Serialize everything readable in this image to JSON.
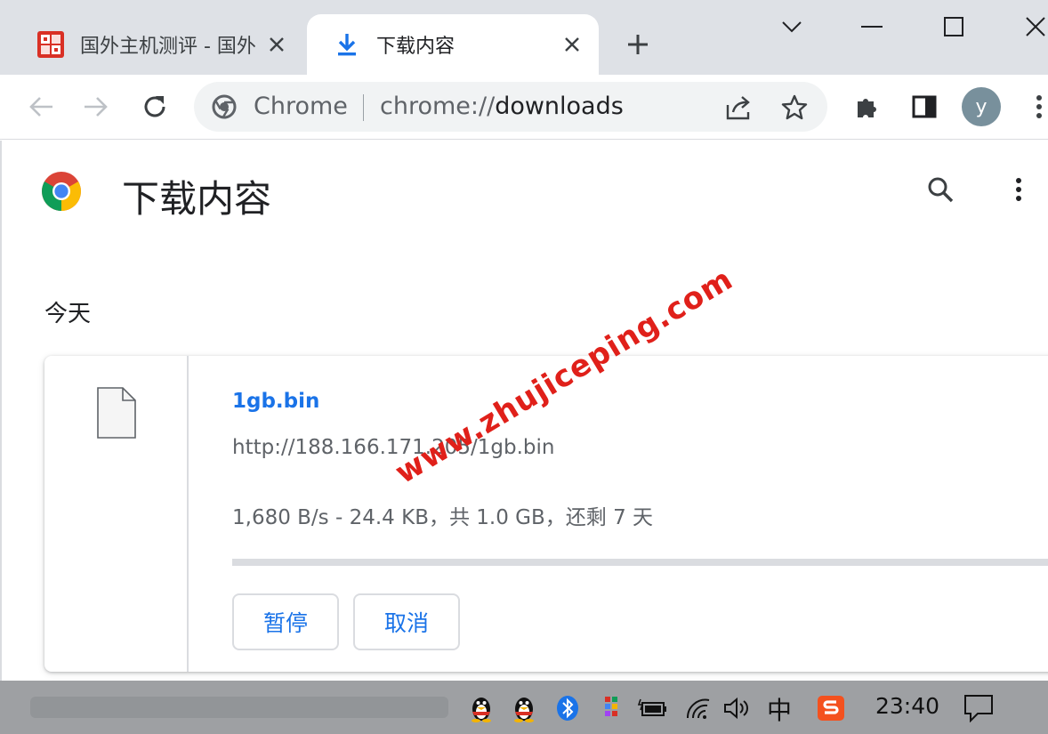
{
  "tabs": [
    {
      "title": "国外主机测评 - 国外",
      "favicon": "site-seal-icon",
      "active": false
    },
    {
      "title": "下载内容",
      "favicon": "download-arrow-icon",
      "active": true
    }
  ],
  "toolbar": {
    "omnibox_scheme": "Chrome",
    "omnibox_url_dim": "chrome://",
    "omnibox_url_main": "downloads",
    "avatar_letter": "y"
  },
  "page": {
    "title": "下载内容",
    "section_date": "今天"
  },
  "download": {
    "file_name": "1gb.bin",
    "url": "http://188.166.171.205/1gb.bin",
    "status": "1,680 B/s - 24.4 KB，共 1.0 GB，还剩 7 天",
    "progress_fraction": 2e-05,
    "pause_label": "暂停",
    "cancel_label": "取消"
  },
  "watermark": "www.zhujiceping.com",
  "taskbar": {
    "ime_label": "中",
    "clock": "23:40"
  },
  "colors": {
    "accent": "#1a73e8",
    "watermark": "#e0201a",
    "tabstrip": "#dee1e6"
  }
}
